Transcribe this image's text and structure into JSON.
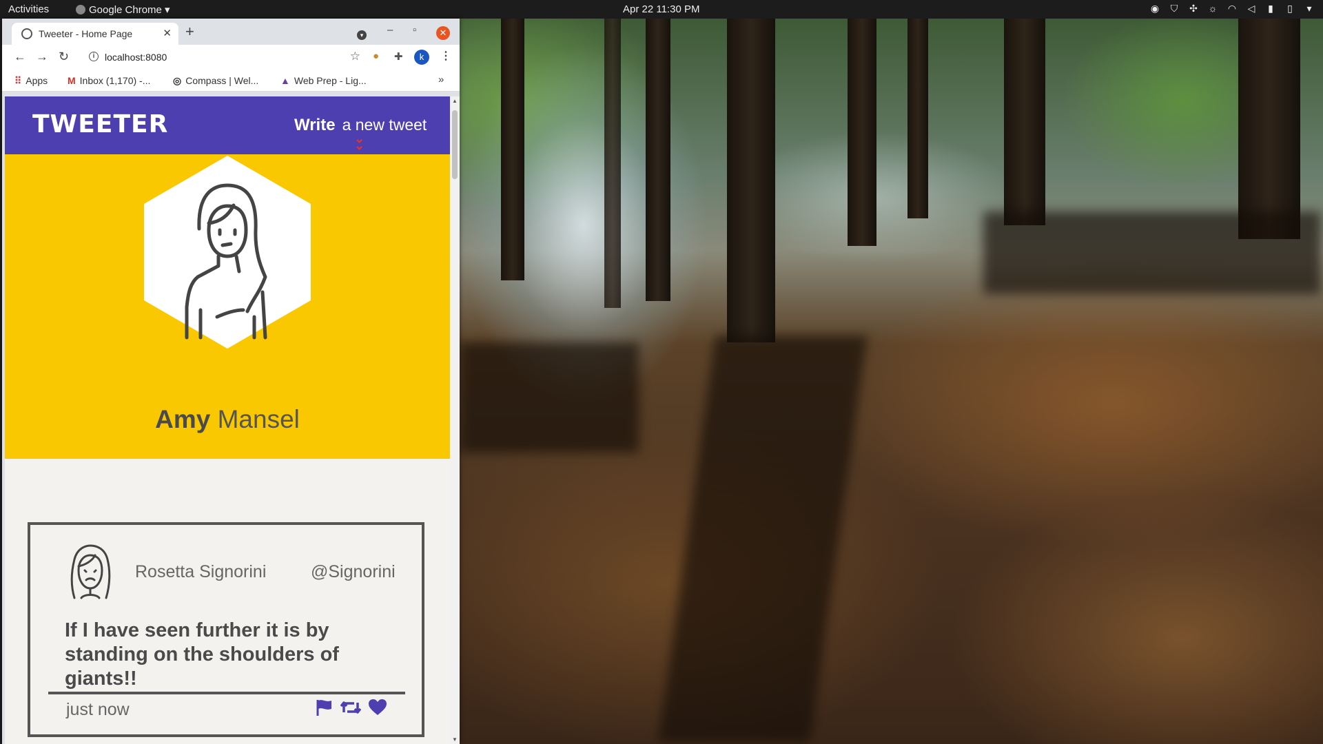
{
  "system_bar": {
    "activities": "Activities",
    "app_name": "Google Chrome",
    "clock": "Apr 22  11:30 PM"
  },
  "browser": {
    "tab_title": "Tweeter - Home Page",
    "url": "localhost:8080",
    "profile_initial": "k",
    "bookmarks": [
      {
        "label": "Apps"
      },
      {
        "label": "Inbox (1,170) -..."
      },
      {
        "label": "Compass | Wel..."
      },
      {
        "label": "Web Prep - Lig..."
      }
    ]
  },
  "page": {
    "brand": "TWEETER",
    "compose_bold": "Write",
    "compose_rest": "a new tweet",
    "profile": {
      "first_name": "Amy",
      "last_name": "Mansel"
    },
    "tweet": {
      "name": "Rosetta Signorini",
      "handle": "@Signorini",
      "text": "If I have seen further it is by standing on the shoulders of giants!!",
      "time": "just now"
    }
  },
  "colors": {
    "nav_purple": "#4e3fb0",
    "hero_yellow": "#fac800",
    "page_bg": "#f4f2ee",
    "accent_red": "#e5332a"
  }
}
